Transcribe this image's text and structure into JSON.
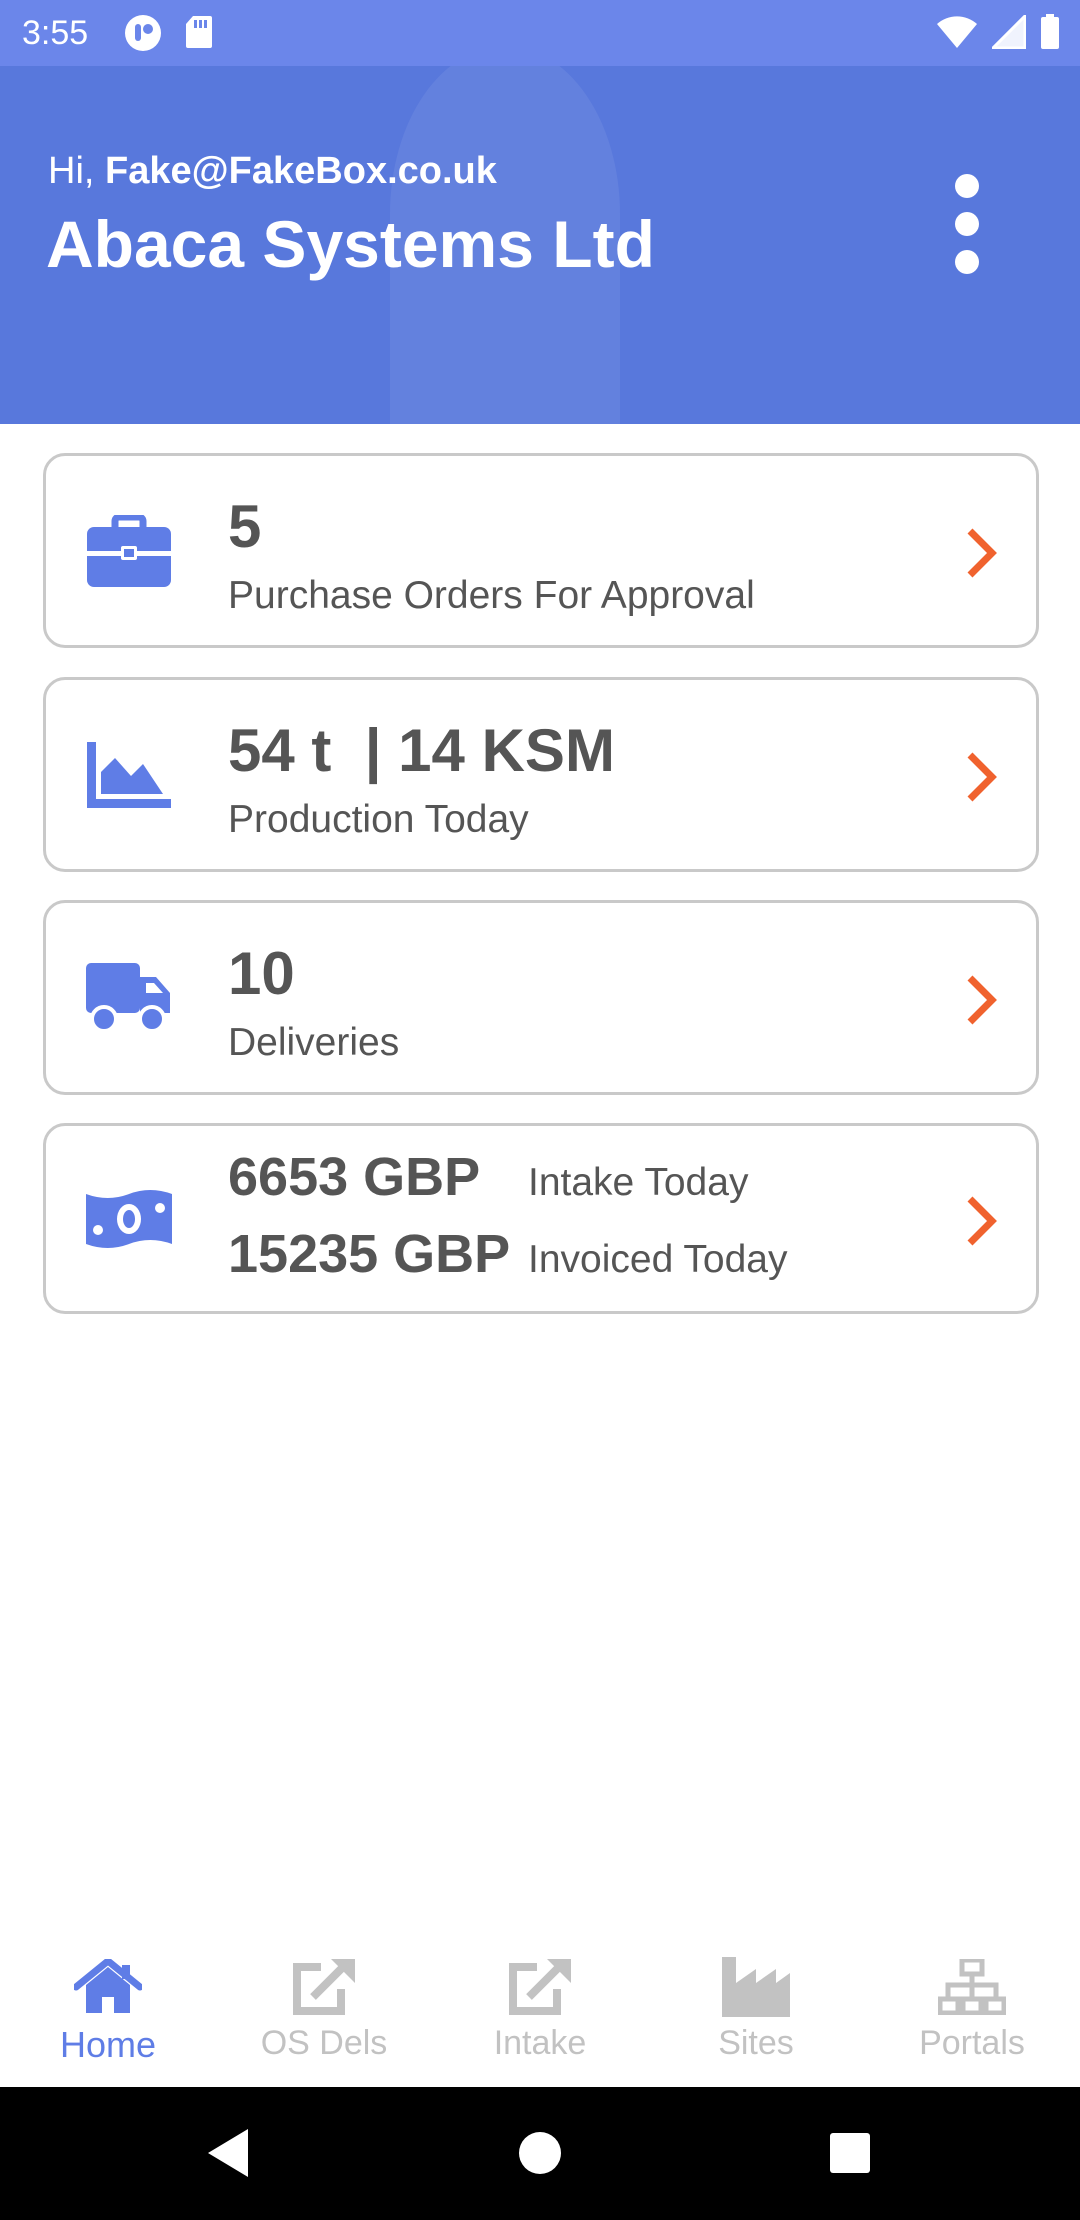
{
  "status_bar": {
    "time": "3:55",
    "left_icons": [
      "assistant-icon",
      "sd-card-icon"
    ],
    "right_icons": [
      "wifi-icon",
      "signal-icon",
      "battery-icon"
    ]
  },
  "header": {
    "greeting_prefix": "Hi,",
    "user_email": "Fake@FakeBox.co.uk",
    "company_name": "Abaca Systems Ltd",
    "menu_icon": "more-vertical-icon",
    "background_color": "#5878dc"
  },
  "cards": [
    {
      "icon": "briefcase-icon",
      "value": "5",
      "label": "Purchase Orders For Approval"
    },
    {
      "icon": "area-chart-icon",
      "value": "54 t  | 14 KSM",
      "label": "Production Today"
    },
    {
      "icon": "truck-icon",
      "value": "10",
      "label": "Deliveries"
    },
    {
      "icon": "money-bill-icon",
      "rows": [
        {
          "amount": "6653 GBP",
          "label": "Intake Today"
        },
        {
          "amount": "15235 GBP",
          "label": "Invoiced Today"
        }
      ]
    }
  ],
  "colors": {
    "accent": "#5f7de6",
    "chevron": "#f0622e",
    "text": "#555555",
    "inactive_nav": "#c2c2c2"
  },
  "bottom_nav": {
    "items": [
      {
        "label": "Home",
        "icon": "home-icon",
        "active": true
      },
      {
        "label": "OS Dels",
        "icon": "external-edit-icon",
        "active": false
      },
      {
        "label": "Intake",
        "icon": "external-edit-icon",
        "active": false
      },
      {
        "label": "Sites",
        "icon": "factory-icon",
        "active": false
      },
      {
        "label": "Portals",
        "icon": "network-icon",
        "active": false
      }
    ]
  }
}
